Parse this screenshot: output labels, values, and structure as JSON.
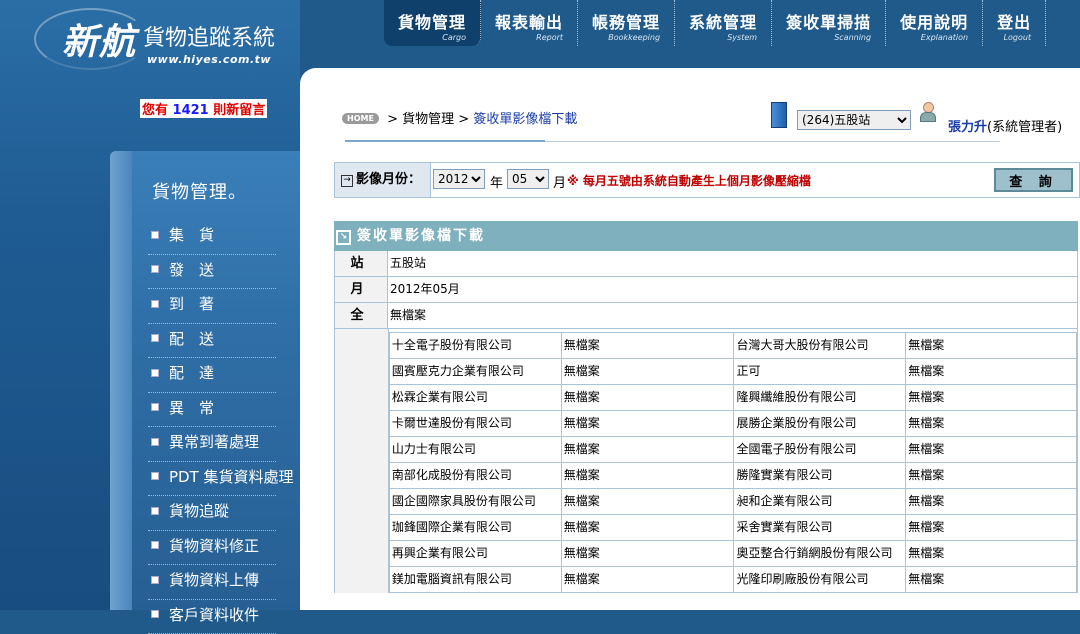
{
  "brand": {
    "name_main": "新航",
    "name_sub": "貨物追蹤系統",
    "url": "www.hiyes.com.tw"
  },
  "message": {
    "prefix": "您有",
    "count": "1421",
    "suffix": "則新留言"
  },
  "nav": [
    {
      "label": "貨物管理",
      "en": "Cargo",
      "active": true
    },
    {
      "label": "報表輸出",
      "en": "Report"
    },
    {
      "label": "帳務管理",
      "en": "Bookkeeping"
    },
    {
      "label": "系統管理",
      "en": "System"
    },
    {
      "label": "簽收單掃描",
      "en": "Scanning"
    },
    {
      "label": "使用說明",
      "en": "Explanation"
    },
    {
      "label": "登出",
      "en": "Logout"
    }
  ],
  "sidebar": {
    "title": "貨物管理。",
    "items": [
      "集　貨",
      "發　送",
      "到　著",
      "配　送",
      "配　達",
      "異　常",
      "異常到著處理",
      "PDT 集貨資料處理",
      "貨物追蹤",
      "貨物資料修正",
      "貨物資料上傳",
      "客戶資料收件"
    ]
  },
  "breadcrumb": {
    "home": "HOME",
    "section": "貨物管理",
    "current": "簽收單影像檔下載"
  },
  "station": {
    "selected": "(264)五股站"
  },
  "user": {
    "name": "張力升",
    "role": "(系統管理者)"
  },
  "query": {
    "label": "影像月份：",
    "year": "2012",
    "year_unit": "年",
    "month": "05",
    "month_unit": "月",
    "note": "※ 每月五號由系統自動產生上個月影像壓縮檔",
    "button": "查 詢"
  },
  "result": {
    "title": "簽收單影像檔下載",
    "station_key": "站 所",
    "station_val": "五股站",
    "month_key": "月 份",
    "month_val": "2012年05月",
    "all_key": "全 部",
    "all_val": "無檔案",
    "rows": [
      [
        "十全電子股份有限公司",
        "無檔案",
        "台灣大哥大股份有限公司",
        "無檔案"
      ],
      [
        "國賓壓克力企業有限公司",
        "無檔案",
        "正可",
        "無檔案"
      ],
      [
        "松霖企業有限公司",
        "無檔案",
        "隆興纖維股份有限公司",
        "無檔案"
      ],
      [
        "卡爾世達股份有限公司",
        "無檔案",
        "展勝企業股份有限公司",
        "無檔案"
      ],
      [
        "山力士有限公司",
        "無檔案",
        "全國電子股份有限公司",
        "無檔案"
      ],
      [
        "南部化成股份有限公司",
        "無檔案",
        "勝隆實業有限公司",
        "無檔案"
      ],
      [
        "國企國際家具股份有限公司",
        "無檔案",
        "昶和企業有限公司",
        "無檔案"
      ],
      [
        "珈鋒國際企業有限公司",
        "無檔案",
        "采舍實業有限公司",
        "無檔案"
      ],
      [
        "再興企業有限公司",
        "無檔案",
        "奧亞整合行銷網股份有限公司",
        "無檔案"
      ],
      [
        "鎂加電腦資訊有限公司",
        "無檔案",
        "光隆印刷廠股份有限公司",
        "無檔案"
      ]
    ]
  }
}
